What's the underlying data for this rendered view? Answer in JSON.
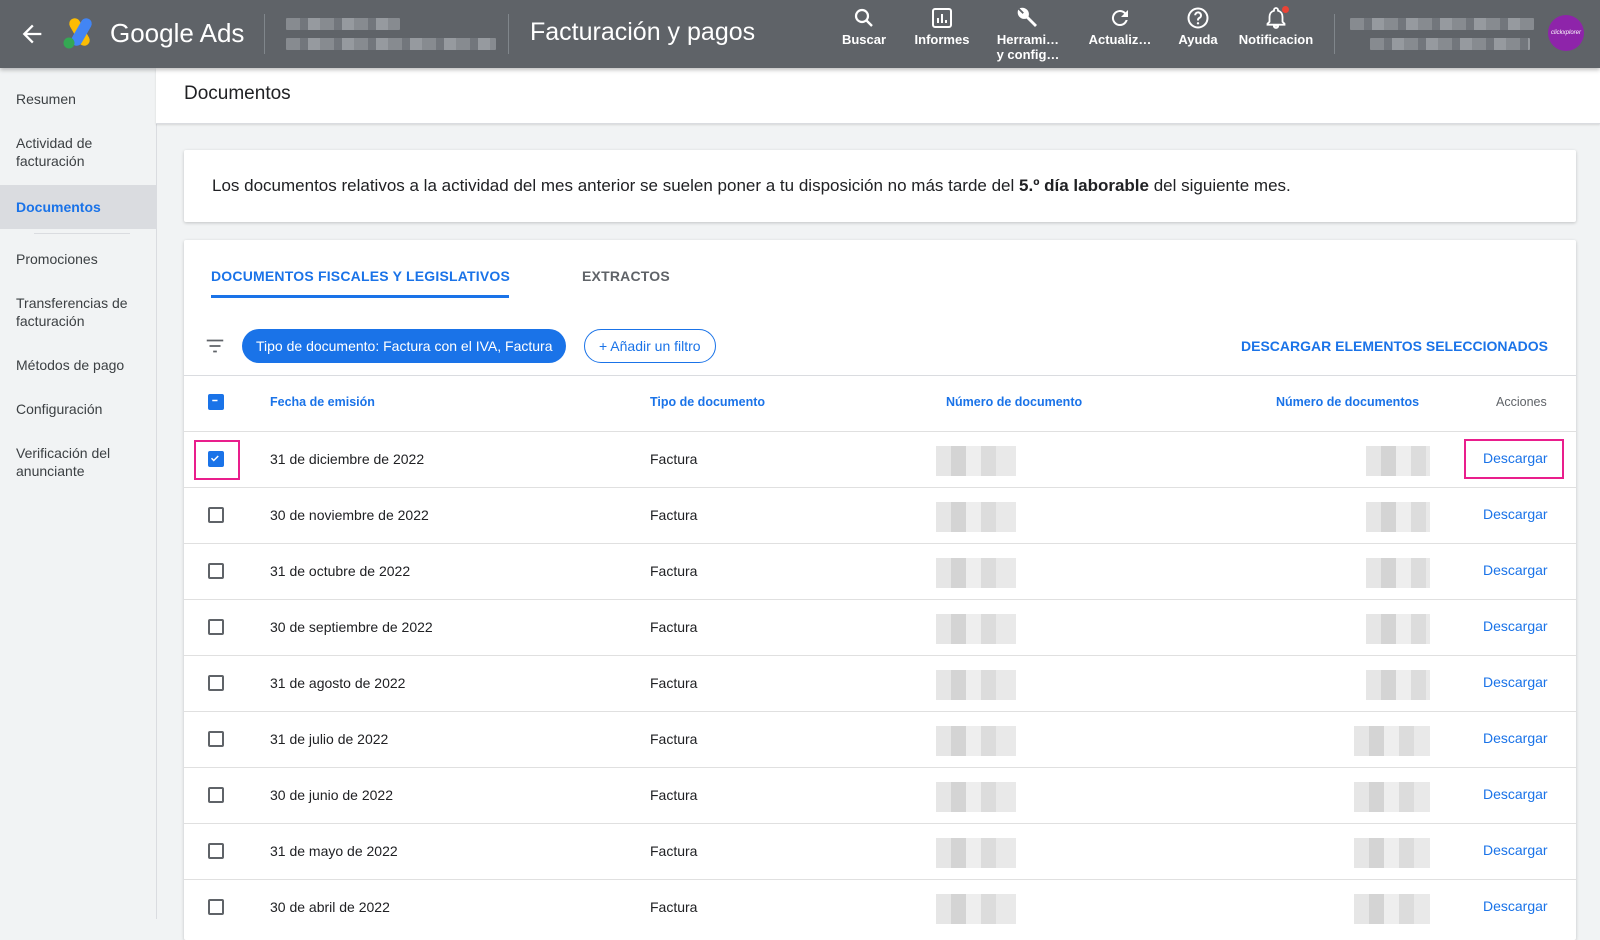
{
  "topbar": {
    "brand": "Google Ads",
    "page_title": "Facturación y pagos",
    "items": [
      {
        "label": "Buscar",
        "icon": "search-icon"
      },
      {
        "label": "Informes",
        "icon": "reports-icon"
      },
      {
        "label": "Herrami…",
        "label2": "y config…",
        "icon": "wrench-icon"
      },
      {
        "label": "Actualiz…",
        "icon": "refresh-icon"
      },
      {
        "label": "Ayuda",
        "icon": "help-icon"
      },
      {
        "label": "Notificacion",
        "icon": "bell-icon"
      }
    ],
    "avatar_text": "clickxplorer"
  },
  "sidebar": {
    "items": [
      {
        "label": "Resumen"
      },
      {
        "label": "Actividad de facturación"
      },
      {
        "label": "Documentos",
        "active": true
      },
      {
        "label": "Promociones"
      },
      {
        "label": "Transferencias de facturación"
      },
      {
        "label": "Métodos de pago"
      },
      {
        "label": "Configuración"
      },
      {
        "label": "Verificación del anunciante"
      }
    ]
  },
  "header": {
    "title": "Documentos"
  },
  "notice": {
    "before": "Los documentos relativos a la actividad del mes anterior se suelen poner a tu disposición no más tarde del ",
    "bold": "5.º día laborable",
    "after": " del siguiente mes."
  },
  "tabs": [
    {
      "label": "DOCUMENTOS FISCALES Y LEGISLATIVOS",
      "active": true
    },
    {
      "label": "EXTRACTOS",
      "active": false
    }
  ],
  "filters": {
    "active_chip": "Tipo de documento: Factura con el IVA, Factura",
    "add_chip": "+ Añadir un filtro",
    "download_selected": "DESCARGAR ELEMENTOS SELECCIONADOS"
  },
  "table": {
    "columns": [
      "Fecha de emisión",
      "Tipo de documento",
      "Número de documento",
      "Número de documentos",
      "Acciones"
    ],
    "rows": [
      {
        "date": "31 de diciembre de 2022",
        "type": "Factura",
        "action": "Descargar",
        "checked": true
      },
      {
        "date": "30 de noviembre de 2022",
        "type": "Factura",
        "action": "Descargar",
        "checked": false
      },
      {
        "date": "31 de octubre de 2022",
        "type": "Factura",
        "action": "Descargar",
        "checked": false
      },
      {
        "date": "30 de septiembre de 2022",
        "type": "Factura",
        "action": "Descargar",
        "checked": false
      },
      {
        "date": "31 de agosto de 2022",
        "type": "Factura",
        "action": "Descargar",
        "checked": false
      },
      {
        "date": "31 de julio de 2022",
        "type": "Factura",
        "action": "Descargar",
        "checked": false
      },
      {
        "date": "30 de junio de 2022",
        "type": "Factura",
        "action": "Descargar",
        "checked": false
      },
      {
        "date": "31 de mayo de 2022",
        "type": "Factura",
        "action": "Descargar",
        "checked": false
      },
      {
        "date": "30 de abril de 2022",
        "type": "Factura",
        "action": "Descargar",
        "checked": false
      }
    ]
  },
  "colors": {
    "accent": "#1a73e8",
    "topbar": "#5f6368",
    "highlight": "#e91e8c"
  }
}
